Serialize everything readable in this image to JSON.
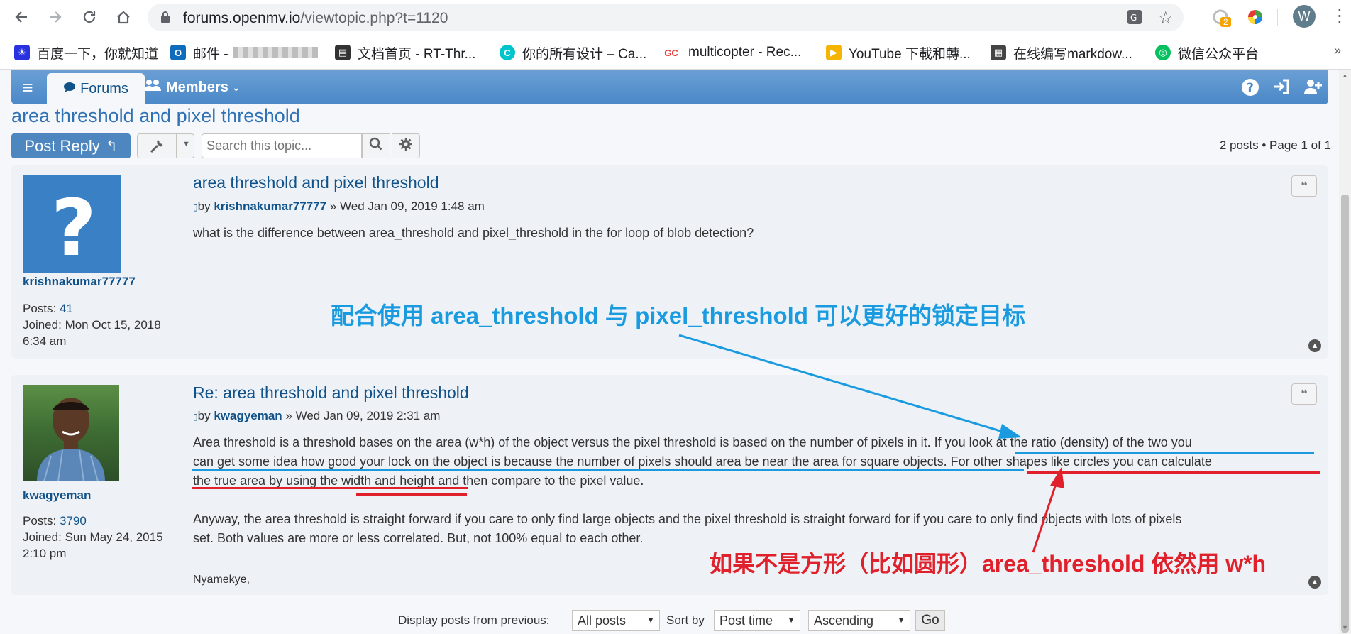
{
  "browser": {
    "url_host": "forums.openmv.io",
    "url_path": "/viewtopic.php?t=1120",
    "profile_initial": "W",
    "extension_badge": "2",
    "bookmarks": [
      {
        "label": "百度一下，你就知道",
        "icon": "baidu-paw-icon",
        "color": "#2932e1"
      },
      {
        "label": "邮件 -",
        "icon": "outlook-icon",
        "color": "#0f6cbd"
      },
      {
        "label": "文档首页 - RT-Thr...",
        "icon": "book-icon",
        "color": "#333333"
      },
      {
        "label": "你的所有设计 – Ca...",
        "icon": "canva-icon",
        "color": "#00c4cc"
      },
      {
        "label": "multicopter - Rec...",
        "icon": "gc-icon",
        "color": "#e53935"
      },
      {
        "label": "YouTube 下載和轉...",
        "icon": "youtube-downloader-icon",
        "color": "#f5b400"
      },
      {
        "label": "在线编写markdow...",
        "icon": "qr-icon",
        "color": "#444444"
      },
      {
        "label": "微信公众平台",
        "icon": "wechat-icon",
        "color": "#07c160"
      }
    ]
  },
  "navbar": {
    "forums_label": "Forums",
    "members_label": "Members"
  },
  "topic": {
    "title": "area threshold and pixel threshold",
    "post_reply_label": "Post Reply",
    "search_placeholder": "Search this topic...",
    "pagination": "2 posts • Page 1 of 1"
  },
  "posts": [
    {
      "author": "krishnakumar77777",
      "posts_label": "Posts:",
      "posts_count": "41",
      "joined_label": "Joined:",
      "joined": "Mon Oct 15, 2018 6:34 am",
      "title": "area threshold and pixel threshold",
      "by": "by",
      "date": "» Wed Jan 09, 2019 1:48 am",
      "body": "what is the difference between area_threshold and pixel_threshold in the for loop of blob detection?"
    },
    {
      "author": "kwagyeman",
      "posts_label": "Posts:",
      "posts_count": "3790",
      "joined_label": "Joined:",
      "joined": "Sun May 24, 2015 2:10 pm",
      "title": "Re: area threshold and pixel threshold",
      "by": "by",
      "date": "» Wed Jan 09, 2019 2:31 am",
      "body_line1": "Area threshold is a threshold bases on the area (w*h) of the object versus the pixel threshold is based on the number of pixels in it. If you look at the ratio (density) of the two you",
      "body_line2": "can get some idea how good your lock on the object is because the number of pixels should area be near the area for square objects. For other shapes like circles you can calculate",
      "body_line3": "the true area by using the width and height and then compare to the pixel value.",
      "body_line4": "Anyway, the area threshold is straight forward if you care to only find large objects and the pixel threshold is straight forward for if you care to only find objects with lots of pixels",
      "body_line5": "set. Both values are more or less correlated. But, not 100% equal to each other.",
      "signature": "Nyamekye,"
    }
  ],
  "bottom": {
    "display_label": "Display posts from previous:",
    "display_value": "All posts",
    "sort_label": "Sort by",
    "sort_value": "Post time",
    "order_value": "Ascending",
    "go_label": "Go"
  },
  "annotations": {
    "blue_note": "配合使用 area_threshold 与 pixel_threshold 可以更好的锁定目标",
    "red_note": "如果不是方形（比如圆形）area_threshold 依然用 w*h",
    "blue_color": "#1a9be0",
    "red_color": "#e0202a"
  }
}
